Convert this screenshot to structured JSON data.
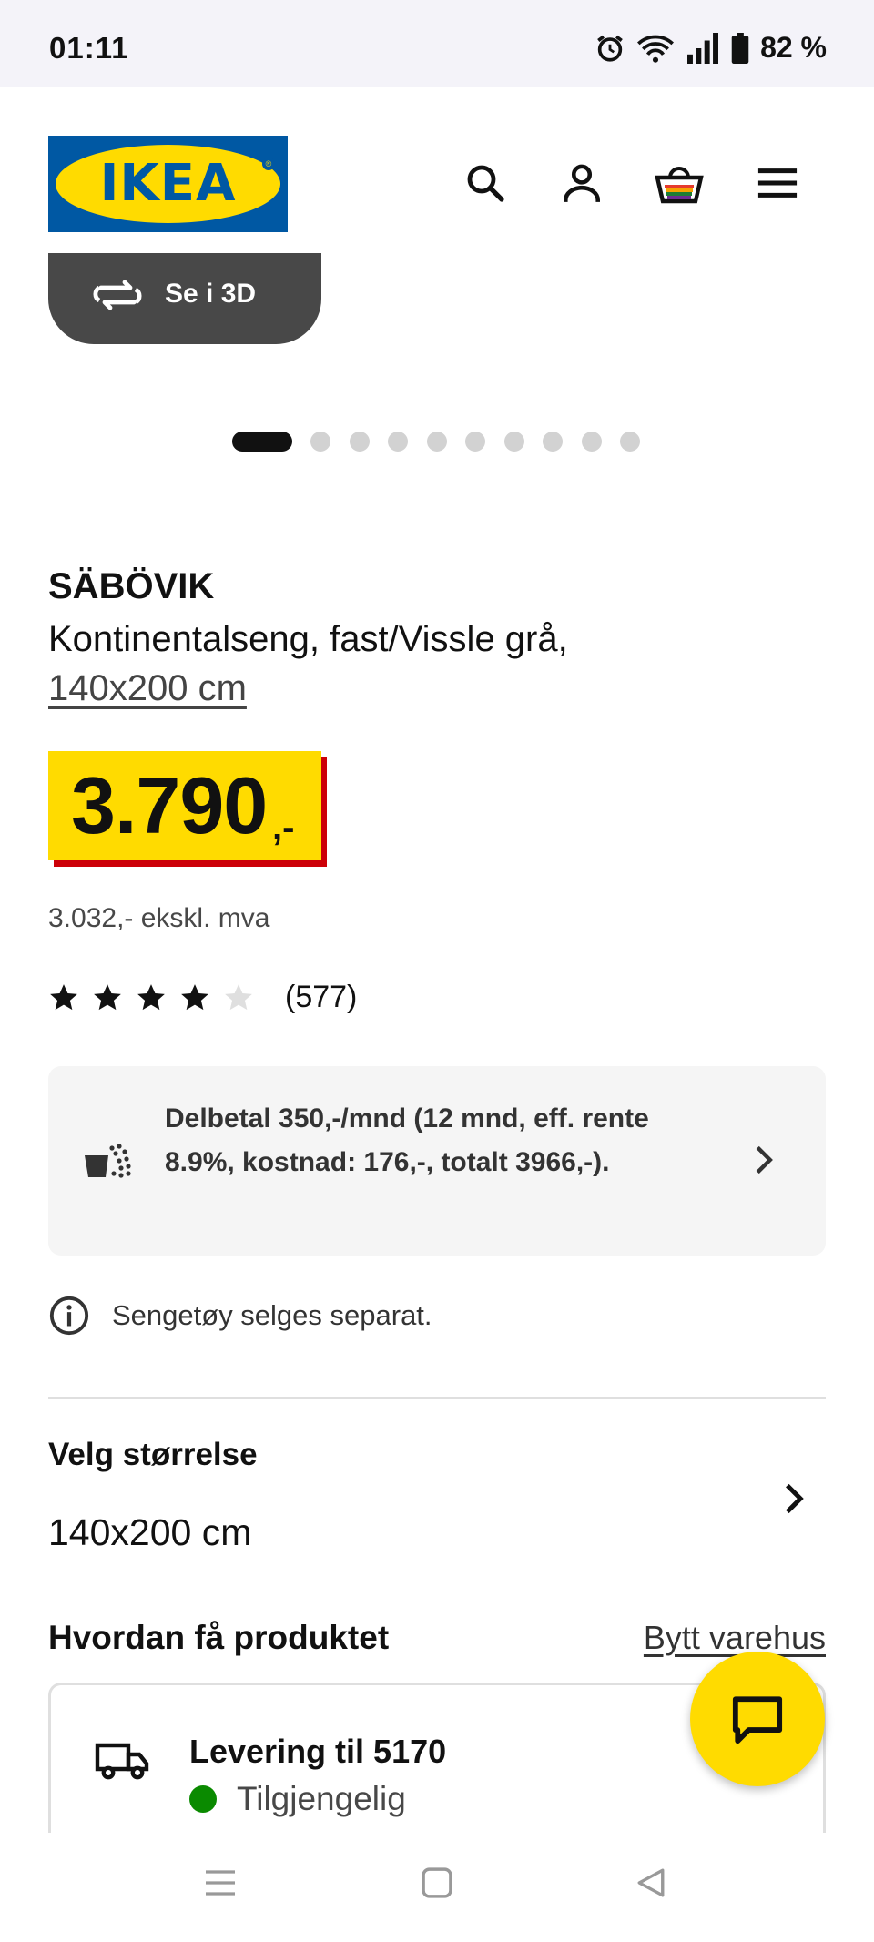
{
  "status_bar": {
    "time": "01:11",
    "battery": "82 %"
  },
  "header": {
    "logo_text": "IKEA",
    "icons": [
      "search-icon",
      "profile-icon",
      "basket-icon",
      "menu-icon"
    ]
  },
  "media": {
    "view_3d_label": "Se i 3D",
    "carousel_count": 10,
    "carousel_active": 1
  },
  "product": {
    "name": "SÄBÖVIK",
    "description": "Kontinentalseng, fast/Vissle grå,",
    "size_link": "140x200 cm",
    "price": "3.790",
    "price_suffix": ",-",
    "price_ex_vat": "3.032,- ekskl. mva",
    "rating_value": 4,
    "rating_max": 5,
    "review_count": "(577)"
  },
  "installment": {
    "text": "Delbetal 350,-/mnd (12 mnd, eff. rente 8.9%, kostnad: 176,-, totalt 3966,-)."
  },
  "notice": {
    "text": "Sengetøy selges separat."
  },
  "size_selector": {
    "label": "Velg størrelse",
    "value": "140x200 cm"
  },
  "fulfillment": {
    "title": "Hvordan få produktet",
    "change_store_label": "Bytt varehus",
    "delivery_title": "Levering til 5170",
    "delivery_status": "Tilgjengelig"
  },
  "colors": {
    "ikea_blue": "#0058a3",
    "ikea_yellow": "#ffdb00",
    "price_red": "#cc0008",
    "available_green": "#0a8a00"
  }
}
